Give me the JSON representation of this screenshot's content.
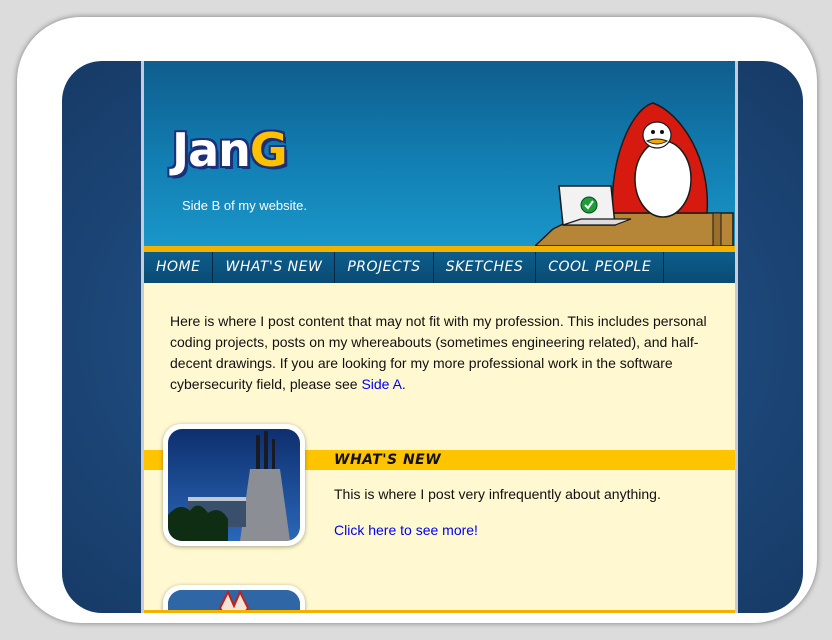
{
  "header": {
    "logo_first": "Jan",
    "logo_last": "G",
    "tagline": "Side B of my website."
  },
  "nav": {
    "items": [
      {
        "label": "Home"
      },
      {
        "label": "What's New"
      },
      {
        "label": "Projects"
      },
      {
        "label": "Sketches"
      },
      {
        "label": "Cool People"
      }
    ]
  },
  "intro": {
    "text": "Here is where I post content that may not fit with my profession. This includes personal coding projects, posts on my whereabouts (sometimes engineering related), and half-decent drawings. If you are looking for my more professional work in the software cybersecurity field, please see",
    "link": "Side A",
    "end": "."
  },
  "section": {
    "title": "What's New",
    "description": "This is where I post very infrequently about anything.",
    "link": "Click here to see more!"
  },
  "colors": {
    "accent_gold": "#ffc400",
    "header_blue": "#127fb3",
    "nav_blue": "#0a4b74",
    "content_bg": "#fff8d0",
    "link": "#0000ee"
  }
}
